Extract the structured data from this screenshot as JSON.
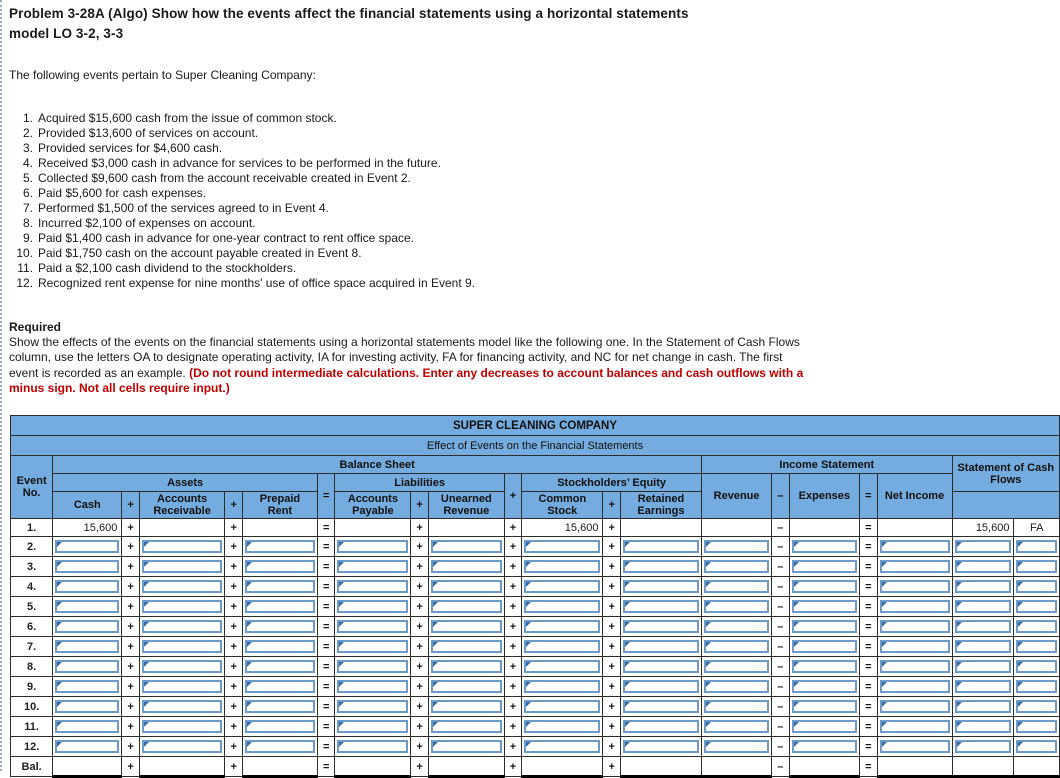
{
  "problem": {
    "title": "Problem 3-28A (Algo) Show how the events affect the financial statements using a horizontal statements model LO 3-2, 3-3",
    "intro": "The following events pertain to Super Cleaning Company:"
  },
  "events": [
    {
      "num": "1.",
      "text": "Acquired $15,600 cash from the issue of common stock."
    },
    {
      "num": "2.",
      "text": "Provided $13,600 of services on account."
    },
    {
      "num": "3.",
      "text": "Provided services for $4,600 cash."
    },
    {
      "num": "4.",
      "text": "Received $3,000 cash in advance for services to be performed in the future."
    },
    {
      "num": "5.",
      "text": "Collected $9,600 cash from the account receivable created in Event 2."
    },
    {
      "num": "6.",
      "text": "Paid $5,600 for cash expenses."
    },
    {
      "num": "7.",
      "text": "Performed $1,500 of the services agreed to in Event 4."
    },
    {
      "num": "8.",
      "text": "Incurred $2,100 of expenses on account."
    },
    {
      "num": "9.",
      "text": "Paid $1,400 cash in advance for one-year contract to rent office space."
    },
    {
      "num": "10.",
      "text": "Paid $1,750 cash on the account payable created in Event 8."
    },
    {
      "num": "11.",
      "text": "Paid a $2,100 cash dividend to the stockholders."
    },
    {
      "num": "12.",
      "text": "Recognized rent expense for nine months' use of office space acquired in Event 9."
    }
  ],
  "required": {
    "label": "Required",
    "body_part1": "Show the effects of the events on the financial statements using a horizontal statements model like the following one. In the Statement of Cash Flows column, use the letters OA to designate operating activity, IA for investing activity, FA for financing activity, and NC for net change in cash. The first event is recorded as an example. ",
    "body_red": "(Do not round intermediate calculations. Enter any decreases to account balances and cash outflows with a minus sign. Not all cells require input.)"
  },
  "table": {
    "company_title": "SUPER CLEANING COMPANY",
    "subtitle": "Effect of Events on the Financial Statements",
    "group_balance_sheet": "Balance Sheet",
    "group_income_statement": "Income Statement",
    "event_no_header": "Event No.",
    "event_no_line1": "Event",
    "event_no_line2": "No.",
    "groups": {
      "assets": "Assets",
      "liabilities": "Liabilities",
      "stockholders_equity": "Stockholders’ Equity"
    },
    "columns": {
      "cash": "Cash",
      "accounts_receivable_l1": "Accounts",
      "accounts_receivable_l2": "Receivable",
      "prepaid_rent_l1": "Prepaid",
      "prepaid_rent_l2": "Rent",
      "accounts_payable_l1": "Accounts",
      "accounts_payable_l2": "Payable",
      "unearned_revenue_l1": "Unearned",
      "unearned_revenue_l2": "Revenue",
      "common_stock_l1": "Common",
      "common_stock_l2": "Stock",
      "retained_earnings_l1": "Retained",
      "retained_earnings_l2": "Earnings",
      "revenue": "Revenue",
      "expenses": "Expenses",
      "net_income": "Net Income",
      "statement_of_cash_flows_l1": "Statement of Cash",
      "statement_of_cash_flows_l2": "Flows"
    },
    "operators": {
      "plus": "+",
      "equals": "=",
      "minus": "–"
    },
    "rows": [
      {
        "label": "1.",
        "editable": false,
        "cash": "15,600",
        "accounts_receivable": "",
        "prepaid_rent": "",
        "accounts_payable": "",
        "unearned_revenue": "",
        "common_stock": "15,600",
        "retained_earnings": "",
        "revenue": "",
        "expenses": "",
        "net_income": "",
        "cash_flow_amount": "15,600",
        "cash_flow_code": "FA"
      },
      {
        "label": "2.",
        "editable": true
      },
      {
        "label": "3.",
        "editable": true
      },
      {
        "label": "4.",
        "editable": true
      },
      {
        "label": "5.",
        "editable": true
      },
      {
        "label": "6.",
        "editable": true
      },
      {
        "label": "7.",
        "editable": true
      },
      {
        "label": "8.",
        "editable": true
      },
      {
        "label": "9.",
        "editable": true
      },
      {
        "label": "10.",
        "editable": true
      },
      {
        "label": "11.",
        "editable": true
      },
      {
        "label": "12.",
        "editable": true
      },
      {
        "label": "Bal.",
        "editable": false,
        "is_balance": true
      }
    ]
  },
  "colors": {
    "header_blue": "#74acdf",
    "required_red": "#c00000",
    "input_border": "#6d9bc9",
    "input_marker": "#3a6ea5",
    "grid_line": "#2c2c2c"
  }
}
